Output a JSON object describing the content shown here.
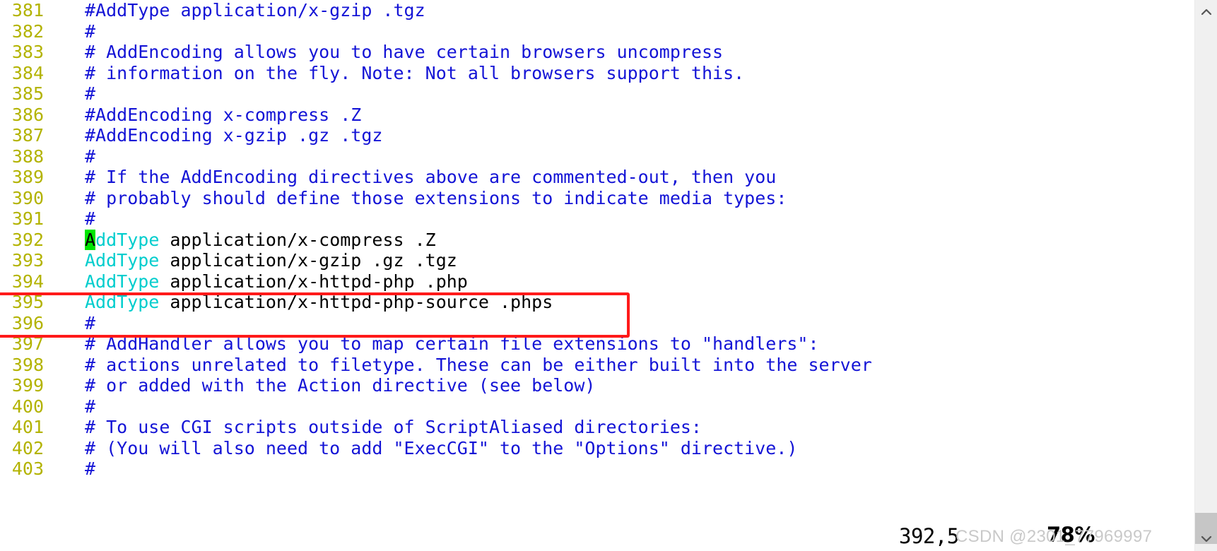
{
  "editor": {
    "app": "vim",
    "file_kind": "apache-httpd-conf",
    "colors": {
      "background": "#ffffff",
      "line_number": "#b3b300",
      "comment": "#1414d6",
      "keyword": "#00cdcd",
      "plain_text": "#000000",
      "cursor_background": "#00e500",
      "annotation_box": "#ff1a1a",
      "watermark": "#c9c9c9",
      "scrollbar_track": "#f0f0f0",
      "scrollbar_thumb": "#c6c6c6"
    },
    "lines": [
      {
        "num": "381",
        "segments": [
          {
            "t": "#AddType application/x-gzip .tgz",
            "c": "cm"
          }
        ]
      },
      {
        "num": "382",
        "segments": [
          {
            "t": "#",
            "c": "cm"
          }
        ]
      },
      {
        "num": "383",
        "segments": [
          {
            "t": "# AddEncoding allows you to have certain browsers uncompress",
            "c": "cm"
          }
        ]
      },
      {
        "num": "384",
        "segments": [
          {
            "t": "# information on the fly. Note: Not all browsers support this.",
            "c": "cm"
          }
        ]
      },
      {
        "num": "385",
        "segments": [
          {
            "t": "#",
            "c": "cm"
          }
        ]
      },
      {
        "num": "386",
        "segments": [
          {
            "t": "#AddEncoding x-compress .Z",
            "c": "cm"
          }
        ]
      },
      {
        "num": "387",
        "segments": [
          {
            "t": "#AddEncoding x-gzip .gz .tgz",
            "c": "cm"
          }
        ]
      },
      {
        "num": "388",
        "segments": [
          {
            "t": "#",
            "c": "cm"
          }
        ]
      },
      {
        "num": "389",
        "segments": [
          {
            "t": "# If the AddEncoding directives above are commented-out, then you",
            "c": "cm"
          }
        ]
      },
      {
        "num": "390",
        "segments": [
          {
            "t": "# probably should define those extensions to indicate media types:",
            "c": "cm"
          }
        ]
      },
      {
        "num": "391",
        "segments": [
          {
            "t": "#",
            "c": "cm"
          }
        ]
      },
      {
        "num": "392",
        "segments": [
          {
            "t": "A",
            "c": "kw cursor"
          },
          {
            "t": "ddType",
            "c": "kw"
          },
          {
            "t": " application/x-compress .Z",
            "c": "tx"
          }
        ]
      },
      {
        "num": "393",
        "segments": [
          {
            "t": "AddType",
            "c": "kw"
          },
          {
            "t": " application/x-gzip .gz .tgz",
            "c": "tx"
          }
        ]
      },
      {
        "num": "394",
        "segments": [
          {
            "t": "AddType",
            "c": "kw"
          },
          {
            "t": " application/x-httpd-php .php",
            "c": "tx"
          }
        ]
      },
      {
        "num": "395",
        "segments": [
          {
            "t": "AddType",
            "c": "kw"
          },
          {
            "t": " application/x-httpd-php-source .phps",
            "c": "tx"
          }
        ]
      },
      {
        "num": "396",
        "segments": [
          {
            "t": "#",
            "c": "cm"
          }
        ]
      },
      {
        "num": "397",
        "segments": [
          {
            "t": "# AddHandler allows you to map certain file extensions to \"handlers\":",
            "c": "cm"
          }
        ]
      },
      {
        "num": "398",
        "segments": [
          {
            "t": "# actions unrelated to filetype. These can be either built into the server",
            "c": "cm"
          }
        ]
      },
      {
        "num": "399",
        "segments": [
          {
            "t": "# or added with the Action directive (see below)",
            "c": "cm"
          }
        ]
      },
      {
        "num": "400",
        "segments": [
          {
            "t": "#",
            "c": "cm"
          }
        ]
      },
      {
        "num": "401",
        "segments": [
          {
            "t": "# To use CGI scripts outside of ScriptAliased directories:",
            "c": "cm"
          }
        ]
      },
      {
        "num": "402",
        "segments": [
          {
            "t": "# (You will also need to add \"ExecCGI\" to the \"Options\" directive.)",
            "c": "cm"
          }
        ]
      },
      {
        "num": "403",
        "segments": [
          {
            "t": "#",
            "c": "cm"
          }
        ]
      }
    ],
    "cursor": {
      "line": "392",
      "column": "5",
      "char": "A"
    }
  },
  "annotation": {
    "highlighted_lines": [
      "394",
      "395"
    ],
    "shape": "rectangle"
  },
  "status": {
    "ruler_position": "392,5",
    "ruler_percent": "78%"
  },
  "watermark": {
    "text": "CSDN @2301_77969997"
  },
  "scrollbar": {
    "up_arrow_icon": "chevron-up-icon",
    "down_arrow_icon": "chevron-down-icon",
    "thumb_position": "near-bottom"
  }
}
